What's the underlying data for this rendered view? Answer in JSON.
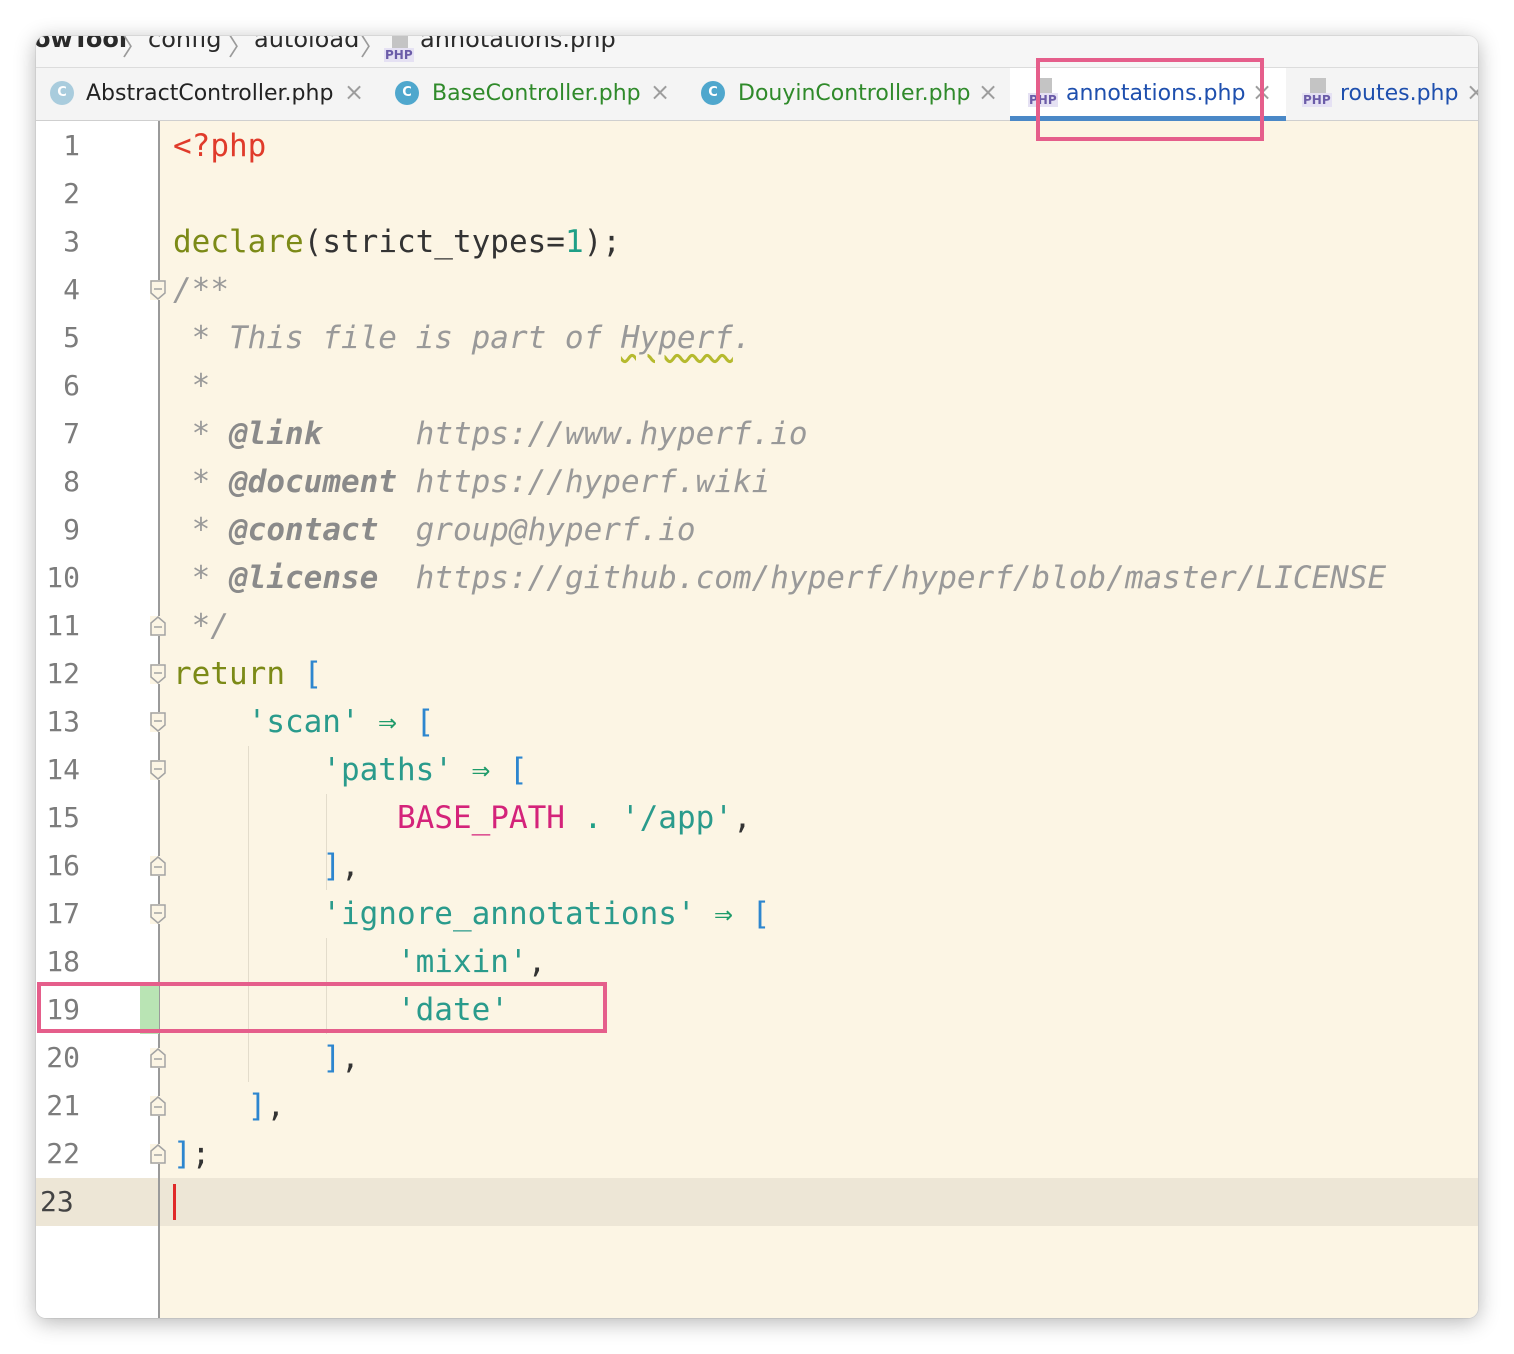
{
  "breadcrumb": {
    "project": "owTool",
    "items": [
      "config",
      "autoload"
    ],
    "file": "annotations.php",
    "file_icon_label": "PHP"
  },
  "tabs": [
    {
      "label": "AbstractController.php",
      "icon": "class-icon",
      "icon_letter": "C",
      "color": "#222222",
      "active": false
    },
    {
      "label": "BaseController.php",
      "icon": "class-icon",
      "icon_letter": "C",
      "color": "#2f8a2a",
      "active": false
    },
    {
      "label": "DouyinController.php",
      "icon": "class-icon",
      "icon_letter": "C",
      "color": "#2f8a2a",
      "active": false
    },
    {
      "label": "annotations.php",
      "icon": "php-file-icon",
      "icon_letter": "PHP",
      "color": "#1e4fae",
      "active": true
    },
    {
      "label": "routes.php",
      "icon": "php-file-icon",
      "icon_letter": "PHP",
      "color": "#1e4fae",
      "active": false
    }
  ],
  "close_glyph": "×",
  "editor": {
    "line_numbers": [
      "1",
      "2",
      "3",
      "4",
      "5",
      "6",
      "7",
      "8",
      "9",
      "10",
      "11",
      "12",
      "13",
      "14",
      "15",
      "16",
      "17",
      "18",
      "19",
      "20",
      "21",
      "22",
      "23"
    ],
    "current_line": "23",
    "changed_line": "19",
    "lines": {
      "l1": {
        "open_tag": "<?php"
      },
      "l3": {
        "keyword": "declare",
        "open": "(",
        "arg": "strict_types=",
        "num": "1",
        "close": ");"
      },
      "l4": {
        "comment": "/**"
      },
      "l5": {
        "prefix": " * This file is part of ",
        "word": "Hyperf",
        "suffix": "."
      },
      "l6": {
        "comment": " *"
      },
      "l7": {
        "star": " * ",
        "tag": "@link",
        "pad": "     ",
        "value": "https://www.hyperf.io"
      },
      "l8": {
        "star": " * ",
        "tag": "@document",
        "pad": " ",
        "value": "https://hyperf.wiki"
      },
      "l9": {
        "star": " * ",
        "tag": "@contact",
        "pad": "  ",
        "value": "group@hyperf.io"
      },
      "l10": {
        "star": " * ",
        "tag": "@license",
        "pad": "  ",
        "value": "https://github.com/hyperf/hyperf/blob/master/LICENSE"
      },
      "l11": {
        "comment": " */"
      },
      "l12": {
        "keyword": "return",
        "space": " ",
        "bracket": "["
      },
      "l13": {
        "indent": "    ",
        "key": "'scan'",
        "arrow": " ⇒ ",
        "bracket": "["
      },
      "l14": {
        "indent": "        ",
        "key": "'paths'",
        "arrow": " ⇒ ",
        "bracket": "["
      },
      "l15": {
        "indent": "            ",
        "const": "BASE_PATH",
        "op": " . ",
        "str": "'/app'",
        "comma": ","
      },
      "l16": {
        "indent": "        ",
        "bracket": "]",
        "comma": ","
      },
      "l17": {
        "indent": "        ",
        "key": "'ignore_annotations'",
        "arrow": " ⇒ ",
        "bracket": "["
      },
      "l18": {
        "indent": "            ",
        "str": "'mixin'",
        "comma": ","
      },
      "l19": {
        "indent": "            ",
        "str": "'date'"
      },
      "l20": {
        "indent": "        ",
        "bracket": "]",
        "comma": ","
      },
      "l21": {
        "indent": "    ",
        "bracket": "]",
        "comma": ","
      },
      "l22": {
        "bracket": "]",
        "semi": ";"
      }
    }
  },
  "colors": {
    "highlight_box": "#e55e8b",
    "editor_bg": "#fcf5e4",
    "active_tab_underline": "#4a88c7"
  }
}
